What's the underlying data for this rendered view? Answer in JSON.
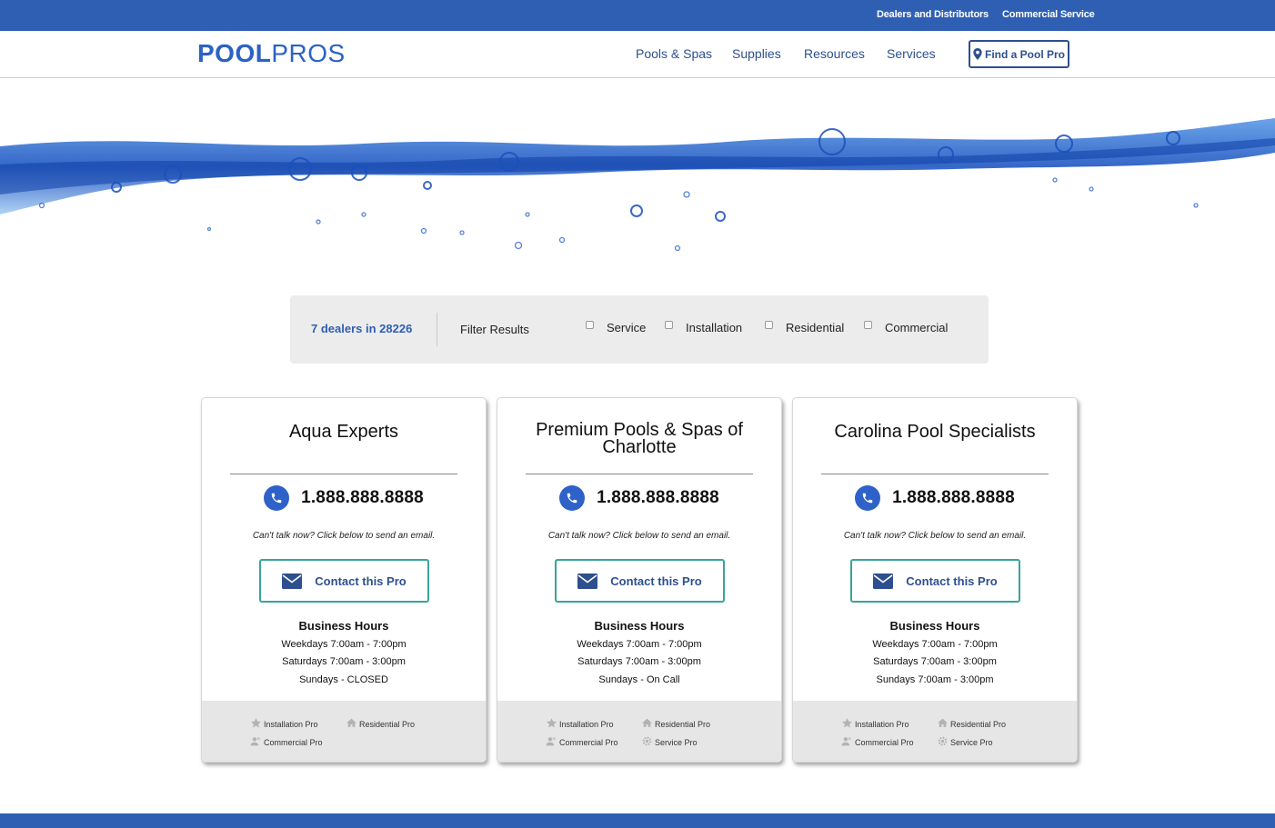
{
  "topbar": {
    "dealers_link": "Dealers and Distributors",
    "commercial_link": "Commercial Service"
  },
  "header": {
    "logo_bold": "POOL",
    "logo_light": "PROS",
    "nav": [
      "Pools & Spas",
      "Supplies",
      "Resources",
      "Services"
    ],
    "find_button": "Find a Pool Pro"
  },
  "filter": {
    "count": "7 dealers in 28226",
    "label": "Filter Results",
    "options": [
      "Service",
      "Installation",
      "Residential",
      "Commercial"
    ]
  },
  "colors": {
    "brand_blue": "#2e5fb3",
    "nav_text": "#2e4f8f",
    "contact_border": "#3aa39a"
  },
  "dealers": [
    {
      "name": "Aqua Experts",
      "phone": "1.888.888.8888",
      "note": "Can't talk now? Click below to send an email.",
      "contact": "Contact this Pro",
      "hours_title": "Business Hours",
      "hours": [
        "Weekdays 7:00am - 7:00pm",
        "Saturdays 7:00am - 3:00pm",
        "Sundays - CLOSED"
      ],
      "badges": [
        "Installation Pro",
        "Residential Pro",
        "Commercial Pro"
      ]
    },
    {
      "name": "Premium Pools & Spas of Charlotte",
      "phone": "1.888.888.8888",
      "note": "Can't talk now? Click below to send an email.",
      "contact": "Contact this Pro",
      "hours_title": "Business Hours",
      "hours": [
        "Weekdays 7:00am - 7:00pm",
        "Saturdays 7:00am - 3:00pm",
        "Sundays - On Call"
      ],
      "badges": [
        "Installation Pro",
        "Residential Pro",
        "Commercial Pro",
        "Service Pro"
      ]
    },
    {
      "name": "Carolina Pool Specialists",
      "phone": "1.888.888.8888",
      "note": "Can't talk now? Click below to send an email.",
      "contact": "Contact this Pro",
      "hours_title": "Business Hours",
      "hours": [
        "Weekdays 7:00am - 7:00pm",
        "Saturdays 7:00am - 3:00pm",
        "Sundays 7:00am - 3:00pm"
      ],
      "badges": [
        "Installation Pro",
        "Residential Pro",
        "Commercial Pro",
        "Service Pro"
      ]
    }
  ]
}
